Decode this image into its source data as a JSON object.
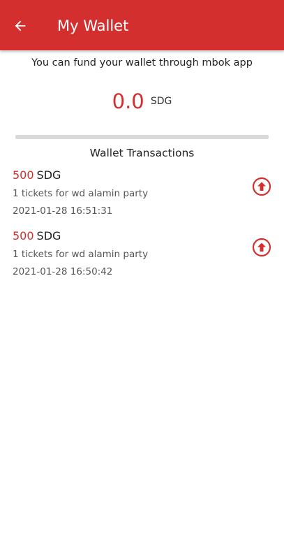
{
  "header": {
    "title": "My Wallet",
    "background_color": "#d32f2f",
    "back_icon": "arrow-left-icon"
  },
  "wallet": {
    "fund_message": "You can fund your wallet through  mbok app",
    "balance": "0.0",
    "currency": "SDG",
    "accent_color": "#d32f2f"
  },
  "transactions_section": {
    "title": "Wallet Transactions",
    "items": [
      {
        "amount": "500",
        "currency": "SDG",
        "description": "1 tickets for wd alamin party",
        "date": "2021-01-28 16:51:31",
        "icon": "arrow-up-circle-icon"
      },
      {
        "amount": "500",
        "currency": "SDG",
        "description": "1 tickets for wd alamin party",
        "date": "2021-01-28 16:50:42",
        "icon": "arrow-up-circle-icon"
      }
    ]
  }
}
